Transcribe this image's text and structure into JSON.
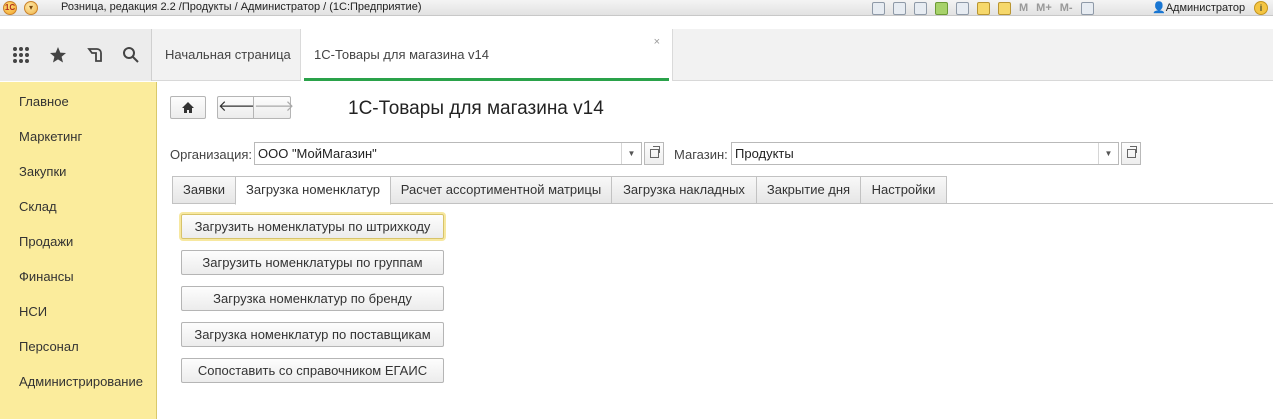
{
  "titlebar": {
    "logo_text": "1С",
    "title": "Розница, редакция 2.2 /Продукты / Администратор /  (1С:Предприятие)",
    "memory_labels": [
      "M",
      "M+",
      "M-"
    ],
    "user": "Администратор",
    "icons": [
      "save-icon",
      "print-icon",
      "print-preview-icon",
      "favorites-add-icon",
      "link-icon",
      "calculator-icon",
      "calendar-icon",
      "memory-icons",
      "window-toggle-icon",
      "user-icon",
      "info-icon"
    ]
  },
  "iconstrip": {
    "icons": [
      "apps-grid-icon",
      "star-icon",
      "history-icon",
      "search-icon"
    ]
  },
  "tabs": {
    "home": "Начальная страница",
    "active": "1С-Товары для магазина v14",
    "close": "×"
  },
  "sidebar": {
    "items": [
      {
        "label": "Главное"
      },
      {
        "label": "Маркетинг"
      },
      {
        "label": "Закупки"
      },
      {
        "label": "Склад"
      },
      {
        "label": "Продажи"
      },
      {
        "label": "Финансы"
      },
      {
        "label": "НСИ"
      },
      {
        "label": "Персонал"
      },
      {
        "label": "Администрирование"
      }
    ],
    "color": "#fbec9c"
  },
  "form": {
    "title": "1С-Товары для магазина v14",
    "org_label": "Организация:",
    "org_value": "ООО \"МойМагазин\"",
    "store_label": "Магазин:",
    "store_value": "Продукты"
  },
  "form_tabs": [
    {
      "label": "Заявки"
    },
    {
      "label": "Загрузка номенклатур"
    },
    {
      "label": "Расчет ассортиментной матрицы"
    },
    {
      "label": "Загрузка накладных"
    },
    {
      "label": "Закрытие дня"
    },
    {
      "label": "Настройки"
    }
  ],
  "active_form_tab": "Загрузка номенклатур",
  "actions": [
    {
      "label": "Загрузить номенклатуры по штрихкоду"
    },
    {
      "label": "Загрузить номенклатуры по группам"
    },
    {
      "label": "Загрузка номенклатур по бренду"
    },
    {
      "label": "Загрузка номенклатур по поставщикам"
    },
    {
      "label": "Сопоставить со справочником ЕГАИС"
    }
  ],
  "colors": {
    "accent": "#2aa24a",
    "sidebar": "#fbec9c"
  }
}
